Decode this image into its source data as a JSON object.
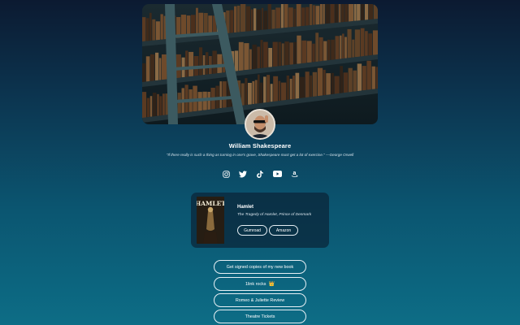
{
  "profile": {
    "name": "William Shakespeare",
    "bio": "\"If there really is such a thing as turning in one's grave, Shakespeare must get a lot of exercise.\" —George Orwell"
  },
  "socials": [
    {
      "icon": "instagram-icon"
    },
    {
      "icon": "twitter-icon"
    },
    {
      "icon": "tiktok-icon"
    },
    {
      "icon": "youtube-icon"
    },
    {
      "icon": "amazon-icon"
    }
  ],
  "book": {
    "cover_text": "HAMLET",
    "title": "Hamlet",
    "subtitle": "The Tragedy of Hamlet, Prince of Denmark",
    "buttons": [
      "Gumroad",
      "Amazon"
    ]
  },
  "links": [
    {
      "label": "Get signed copies of my new book"
    },
    {
      "label": "1link rocks",
      "emoji": "👑"
    },
    {
      "label": "Romeo & Juliette Review"
    },
    {
      "label": "Theatre Tickets"
    }
  ],
  "colors": {
    "bg_top": "#0c1a31",
    "bg_bottom": "#0d6d86",
    "card": "#0a2438",
    "button_border": "#e7f0f5"
  }
}
